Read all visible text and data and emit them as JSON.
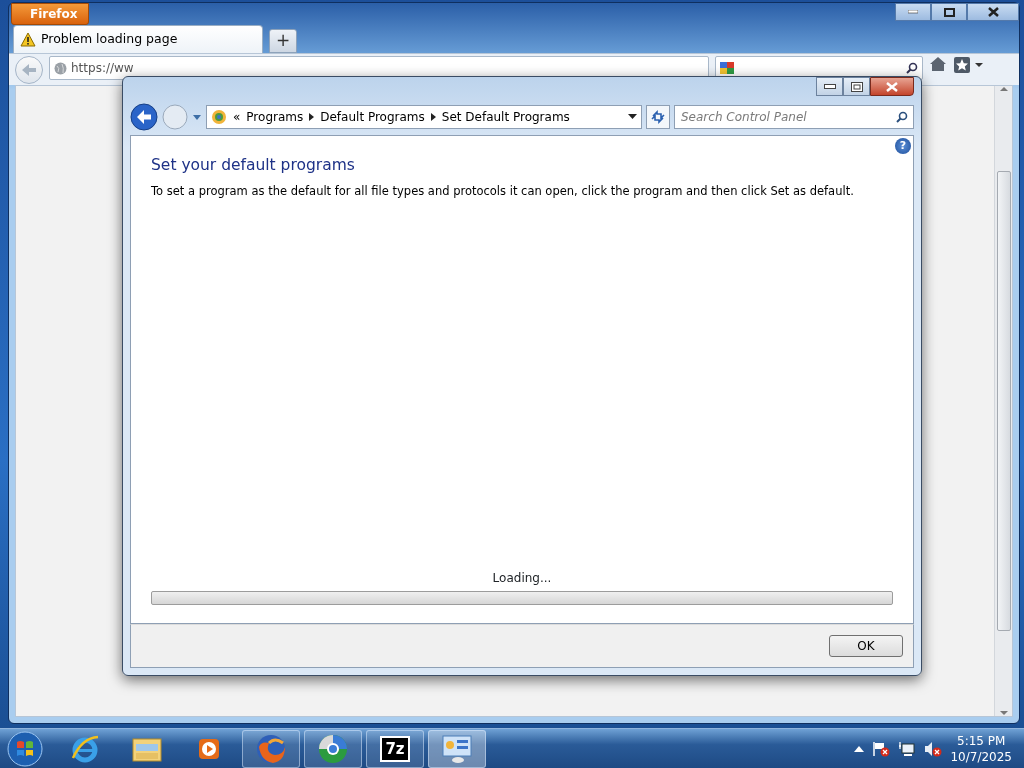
{
  "browser": {
    "menu_button": "Firefox",
    "tabs": [
      {
        "title": "Problem loading page",
        "selected": true
      }
    ],
    "new_tab": "+",
    "address": "https://ww"
  },
  "dialog": {
    "breadcrumb_prefix": "«",
    "breadcrumb": [
      "Programs",
      "Default Programs",
      "Set Default Programs"
    ],
    "search": {
      "placeholder": "Search Control Panel"
    },
    "help": "?",
    "heading": "Set your default programs",
    "description": "To set a program as the default for all file types and protocols it can open, click the program and then click Set as default.",
    "status": "Loading...",
    "progress": {
      "level": 0
    },
    "ok": "OK"
  },
  "taskbar": {
    "apps": [
      {
        "kind": "ie",
        "open": false,
        "active": false
      },
      {
        "kind": "folder",
        "open": false,
        "active": false
      },
      {
        "kind": "media",
        "open": false,
        "active": false
      },
      {
        "kind": "firefox",
        "open": true,
        "active": false
      },
      {
        "kind": "chrome",
        "open": true,
        "active": false
      },
      {
        "kind": "archive",
        "label": "7z",
        "open": true,
        "active": false
      },
      {
        "kind": "control-panel",
        "open": true,
        "active": true
      }
    ],
    "clock": {
      "time": "5:15 PM",
      "date": "10/7/2025"
    }
  }
}
